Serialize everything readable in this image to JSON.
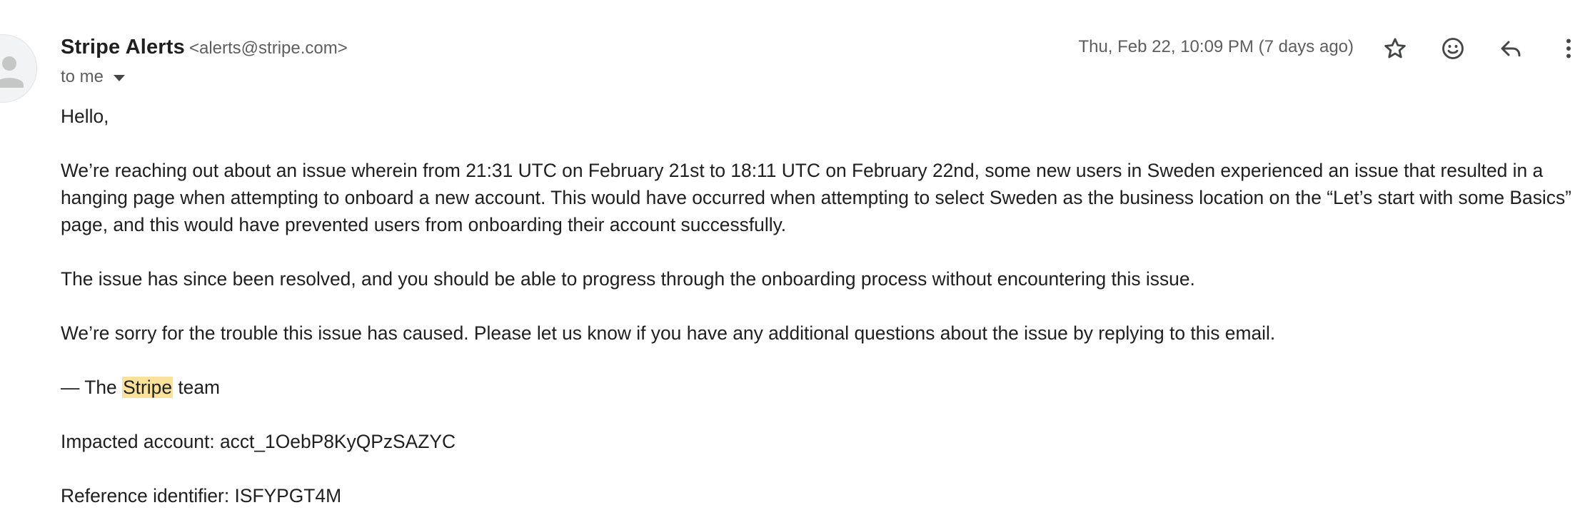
{
  "message": {
    "sender_name": "Stripe Alerts",
    "sender_email": "<alerts@stripe.com>",
    "recipient_label": "to me",
    "date": "Thu, Feb 22, 10:09 PM (7 days ago)"
  },
  "icons": {
    "avatar": "person-icon",
    "star": "star-icon",
    "emoji": "emoji-icon",
    "reply": "reply-icon",
    "more": "more-vert-icon",
    "chevron": "chevron-down-icon"
  },
  "body": {
    "greeting": "Hello,",
    "paragraph1": "We’re reaching out about an issue wherein from 21:31 UTC on February 21st to 18:11 UTC on February 22nd, some new users in Sweden experienced an issue that resulted in a hanging page when attempting to onboard a new account. This would have occurred when attempting to select Sweden as the business location on the “Let’s start with some Basics” page, and this would have prevented users from onboarding their account successfully.",
    "paragraph2": "The issue has since been resolved, and you should be able to progress through the onboarding process without encountering this issue.",
    "paragraph3": "We’re sorry for the trouble this issue has caused. Please let us know if you have any additional questions about the issue by replying to this email.",
    "signoff_prefix": "— The ",
    "signoff_highlight": "Stripe",
    "signoff_suffix": " team",
    "impacted_account": "Impacted account: acct_1OebP8KyQPzSAZYC",
    "reference_identifier": "Reference identifier: ISFYPGT4M"
  },
  "colors": {
    "highlight": "#fbe29a",
    "text": "#1f1f1f",
    "secondary_text": "#5e5e5e",
    "icon": "#444746"
  }
}
